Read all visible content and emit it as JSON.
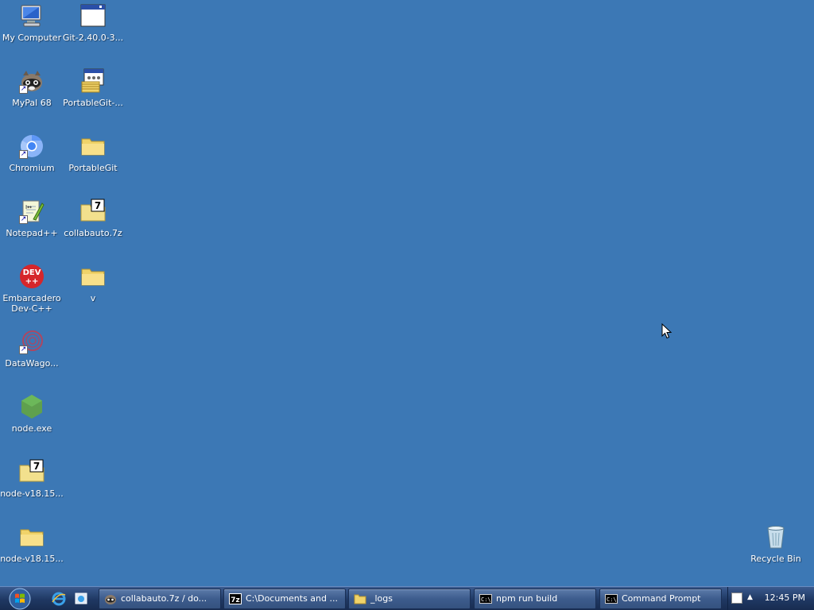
{
  "desktop": {
    "background": "#3c78b5",
    "icons": [
      {
        "label": "My Computer",
        "icon": "computer-icon"
      },
      {
        "label": "MyPal 68",
        "icon": "mypal-icon",
        "shortcut": true
      },
      {
        "label": "Chromium",
        "icon": "chromium-icon",
        "shortcut": true
      },
      {
        "label": "Notepad++",
        "icon": "notepadpp-icon",
        "shortcut": true
      },
      {
        "label": "Embarcadero Dev-C++",
        "icon": "devcpp-icon"
      },
      {
        "label": "DataWago...",
        "icon": "datawagon-icon",
        "shortcut": true
      },
      {
        "label": "node.exe",
        "icon": "nodejs-icon"
      },
      {
        "label": "node-v18.15...",
        "icon": "7z-archive-icon"
      },
      {
        "label": "node-v18.15...",
        "icon": "folder-icon"
      },
      {
        "label": "Git-2.40.0-3...",
        "icon": "installer-window-icon"
      },
      {
        "label": "PortableGit-...",
        "icon": "self-extractor-icon"
      },
      {
        "label": "PortableGit",
        "icon": "folder-icon"
      },
      {
        "label": "collabauto.7z",
        "icon": "7z-archive-icon"
      },
      {
        "label": "v",
        "icon": "folder-icon"
      },
      {
        "label": "Recycle Bin",
        "icon": "recycle-bin-icon"
      }
    ]
  },
  "taskbar": {
    "start_icon": "windows-logo-icon",
    "quick_launch": [
      {
        "icon": "ie-icon"
      },
      {
        "icon": "show-desktop-icon"
      }
    ],
    "buttons": [
      {
        "label": "collabauto.7z / do...",
        "icon": "mypal-icon"
      },
      {
        "label": "C:\\Documents and ...",
        "icon": "7zip-icon"
      },
      {
        "label": "_logs",
        "icon": "folder-icon"
      },
      {
        "label": "npm run build",
        "icon": "cmd-icon"
      },
      {
        "label": "Command Prompt",
        "icon": "cmd-icon"
      }
    ],
    "tray": {
      "clock": "12:45 PM",
      "arrow": "▲"
    }
  }
}
